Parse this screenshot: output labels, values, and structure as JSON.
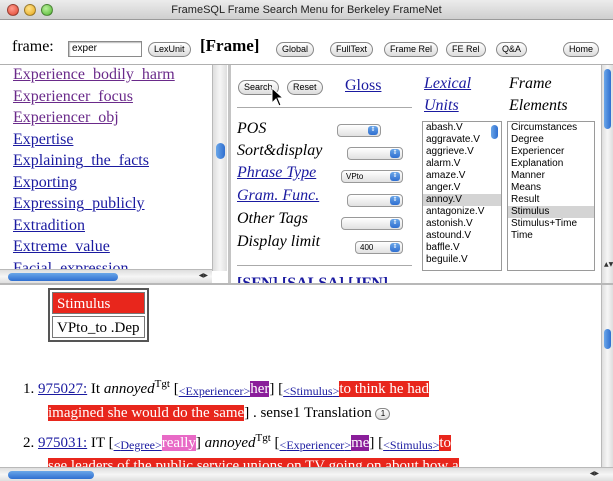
{
  "window": {
    "title": "FrameSQL Frame Search Menu for Berkeley FrameNet"
  },
  "topbar": {
    "frame_label": "frame:",
    "frame_input_value": "exper",
    "lexunit_btn": "LexUnit",
    "frame_title": "[Frame]",
    "global_btn": "Global",
    "fulltext_btn": "FullText",
    "framerel_btn": "Frame Rel",
    "ferel_btn": "FE Rel",
    "qa_btn": "Q&A",
    "home_btn": "Home"
  },
  "frame_list": [
    "Experience_bodily_harm",
    "Experiencer_focus",
    "Experiencer_obj",
    "Expertise",
    "Explaining_the_facts",
    "Exporting",
    "Expressing_publicly",
    "Extradition",
    "Extreme_value",
    "Facial_expression"
  ],
  "search": {
    "search_btn": "Search",
    "reset_btn": "Reset",
    "gloss": "Gloss",
    "pos_label": "POS",
    "sort_label": "Sort&display",
    "phrase_type_label": "Phrase Type",
    "phrase_type_value": "VPto",
    "gram_func_label": "Gram. Func.",
    "other_tags_label": "Other Tags",
    "display_limit_label": "Display limit",
    "display_limit_value": "400",
    "bottom_links": "[SFN] [SALSA] [JFN]"
  },
  "lexical_units": {
    "title_line1": "Lexical",
    "title_line2": "Units",
    "items": [
      "abash.V",
      "aggravate.V",
      "aggrieve.V",
      "alarm.V",
      "amaze.V",
      "anger.V",
      "annoy.V",
      "antagonize.V",
      "astonish.V",
      "astound.V",
      "baffle.V",
      "beguile.V"
    ],
    "selected": "annoy.V"
  },
  "frame_elements": {
    "title_line1": "Frame",
    "title_line2": "Elements",
    "items": [
      "Circumstances",
      "Degree",
      "Experiencer",
      "Explanation",
      "Manner",
      "Means",
      "Result",
      "Stimulus",
      "Stimulus+Time",
      "Time"
    ],
    "selected": "Stimulus"
  },
  "results": {
    "table_row1": "Stimulus",
    "table_row2": "VPto_to .Dep",
    "r1": {
      "num": "1.",
      "id": "975027:",
      "pre": "It",
      "target_word": "annoyed",
      "tgt": "Tgt",
      "exp_label": "Experiencer",
      "exp_text": "her",
      "stim_label": "Stimulus",
      "stim_text": "to think he had",
      "stim_text2": "imagined she would do the same",
      "tail": ". sense1 Translation",
      "circle": "1"
    },
    "r2": {
      "num": "2.",
      "id": "975031:",
      "pre": "IT",
      "deg_label": "Degree",
      "deg_text": "really",
      "target_word": "annoyed",
      "tgt": "Tgt",
      "exp_label": "Experiencer",
      "exp_text": "me",
      "stim_label": "Stimulus",
      "stim_text": "to",
      "stim_text2": "see leaders of the public service unions on TV going on about how a"
    }
  }
}
